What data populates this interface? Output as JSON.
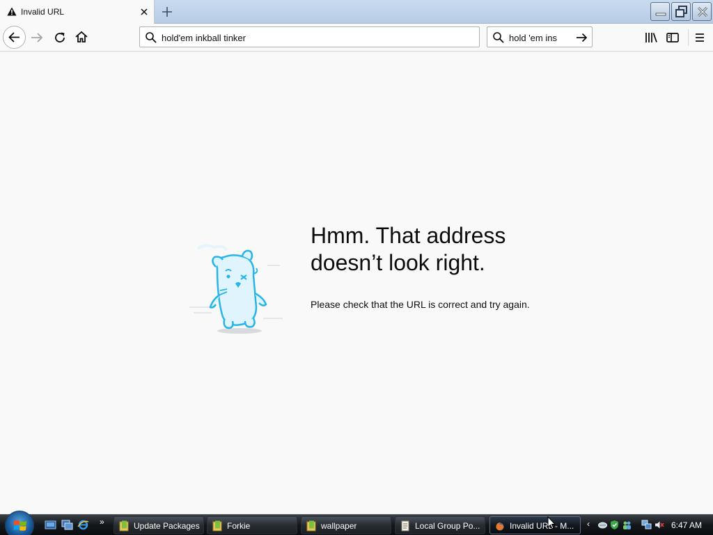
{
  "browser": {
    "tab": {
      "title": "Invalid URL",
      "icon": "warning-icon"
    },
    "url_bar": {
      "value": "hold'em inkball tinker",
      "icon": "search-icon"
    },
    "search_bar": {
      "value": "hold 'em ins",
      "icon": "search-icon"
    }
  },
  "error_page": {
    "title": "Hmm. That address doesn’t look right.",
    "description": "Please check that the URL is correct and try again."
  },
  "taskbar": {
    "buttons": [
      {
        "label": "Update Packages",
        "icon": "folder-icon"
      },
      {
        "label": "Forkie",
        "icon": "folder-icon"
      },
      {
        "label": "wallpaper",
        "icon": "folder-icon"
      },
      {
        "label": "Local Group Po...",
        "icon": "policy-icon"
      },
      {
        "label": "Invalid URL - M...",
        "icon": "firefox-icon",
        "active": true
      }
    ],
    "clock": "6:47 AM"
  },
  "colors": {
    "page_background": "#f9f9fa",
    "text": "#0c0c0d",
    "mascot_blue": "#27b5e8",
    "taskbar": "#14181c"
  }
}
